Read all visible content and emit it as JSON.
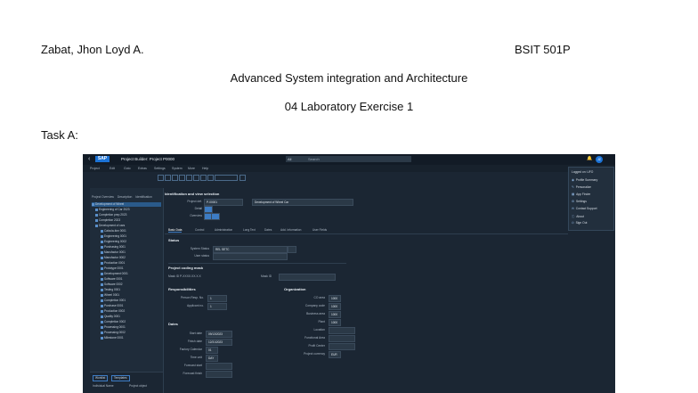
{
  "document": {
    "author": "Zabat, Jhon Loyd A.",
    "section": "BSIT 501P",
    "course": "Advanced System integration and Architecture",
    "exercise": "04 Laboratory Exercise 1",
    "task": "Task A:"
  },
  "screenshot": {
    "shell": {
      "back": "‹",
      "logo": "SAP",
      "app_title": "Project Builder: Project P0000",
      "scope": "All",
      "search_placeholder": "Search",
      "avatar": "JZ",
      "bell": "🔔"
    },
    "menubar": [
      "Project",
      "Edit",
      "Goto",
      "Extras",
      "Settings",
      "System",
      "More",
      "Help"
    ],
    "tree": {
      "header": [
        "Project Overview",
        "Description",
        "Identification"
      ],
      "rows": [
        {
          "text": "Development of Wheel",
          "sel": true
        },
        {
          "text": "Engineering of Car 2023"
        },
        {
          "text": "Completion prep 2023"
        },
        {
          "text": "Completion 2023"
        },
        {
          "text": "Development of cars"
        },
        {
          "text": "Calcula-tion 0001"
        },
        {
          "text": "Engineering 0001"
        },
        {
          "text": "Engineering 0002"
        },
        {
          "text": "Purchasing 0001"
        },
        {
          "text": "Manufactur 0001"
        },
        {
          "text": "Manufactur 0002"
        },
        {
          "text": "Production 0001"
        },
        {
          "text": "Prototype 0001"
        },
        {
          "text": "Development 0001"
        },
        {
          "text": "Software 0001"
        },
        {
          "text": "Software 0002"
        },
        {
          "text": "Testing 0001"
        },
        {
          "text": "Wheel 0001"
        },
        {
          "text": "Completion 0001"
        },
        {
          "text": "Purchase 0001"
        },
        {
          "text": "Production 0002"
        },
        {
          "text": "Quality 0001"
        },
        {
          "text": "Completion 0002"
        },
        {
          "text": "Processing 0001"
        },
        {
          "text": "Processing 0002"
        },
        {
          "text": "Milestone 0001"
        }
      ],
      "tabs": [
        "Worklist",
        "Templates"
      ],
      "footer": [
        "Individual Name",
        "Project object"
      ]
    },
    "main": {
      "section_ident": "Identification and view selection",
      "project_def_label": "Project def.",
      "project_def_value": "P-00001",
      "project_desc_value": "Development of Wheel Car",
      "detail_label": "Detail",
      "overview_label": "Overview",
      "tabs": [
        "Basic Data",
        "Control",
        "Administration",
        "Long Text",
        "Dates",
        "Add. Information",
        "User Fields"
      ],
      "status_title": "Status",
      "system_status_label": "System Status",
      "system_status_value": "REL  SETC",
      "user_status_label": "User status",
      "coding_title": "Project coding mask",
      "mask_label": "Mask ID P-XXXX.XX.X.X",
      "mask_value": "Mask ID",
      "resp_title": "Responsibilities",
      "org_title": "Organization",
      "resp_labels": [
        "Person Resp. No.",
        "Applicant no."
      ],
      "resp_values": [
        "1",
        "1"
      ],
      "org_labels": [
        "CO area",
        "Company code",
        "Business area",
        "Plant",
        "Location",
        "Functional Area",
        "Profit Center",
        "Project currency"
      ],
      "org_values": [
        "1000",
        "1000",
        "1000",
        "1000",
        "",
        "",
        "",
        "EUR"
      ],
      "dates_title": "Dates",
      "date_labels": [
        "Start date",
        "Finish date",
        "Factory Calendar",
        "Time unit",
        "Forecast start",
        "Forecast finish"
      ],
      "date_values": [
        "09/13/2023",
        "12/31/2023",
        "01",
        "DAY",
        "",
        ""
      ]
    },
    "usermenu": {
      "title": "Logged on: UFO",
      "items": [
        "Profile Summary",
        "Personalize",
        "App Finder",
        "Settings",
        "Contact Support",
        "About",
        "Sign Out"
      ]
    }
  }
}
